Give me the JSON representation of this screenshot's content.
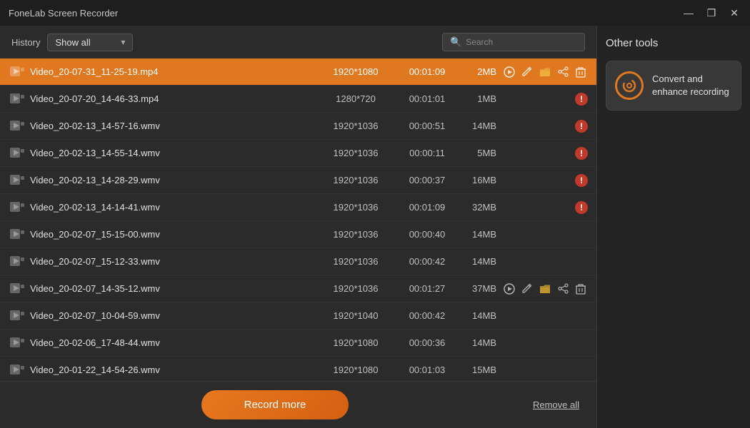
{
  "app": {
    "title": "FoneLab Screen Recorder",
    "window_controls": {
      "minimize": "—",
      "maximize": "❐",
      "close": "✕"
    }
  },
  "header": {
    "history_label": "History",
    "dropdown_value": "Show all",
    "dropdown_arrow": "▾",
    "search_placeholder": "Search"
  },
  "table": {
    "rows": [
      {
        "filename": "Video_20-07-31_11-25-19.mp4",
        "resolution": "1920*1080",
        "duration": "00:01:09",
        "size": "2MB",
        "selected": true,
        "error": false,
        "show_actions": true
      },
      {
        "filename": "Video_20-07-20_14-46-33.mp4",
        "resolution": "1280*720",
        "duration": "00:01:01",
        "size": "1MB",
        "selected": false,
        "error": true,
        "show_actions": false
      },
      {
        "filename": "Video_20-02-13_14-57-16.wmv",
        "resolution": "1920*1036",
        "duration": "00:00:51",
        "size": "14MB",
        "selected": false,
        "error": true,
        "show_actions": false
      },
      {
        "filename": "Video_20-02-13_14-55-14.wmv",
        "resolution": "1920*1036",
        "duration": "00:00:11",
        "size": "5MB",
        "selected": false,
        "error": true,
        "show_actions": false
      },
      {
        "filename": "Video_20-02-13_14-28-29.wmv",
        "resolution": "1920*1036",
        "duration": "00:00:37",
        "size": "16MB",
        "selected": false,
        "error": true,
        "show_actions": false
      },
      {
        "filename": "Video_20-02-13_14-14-41.wmv",
        "resolution": "1920*1036",
        "duration": "00:01:09",
        "size": "32MB",
        "selected": false,
        "error": true,
        "show_actions": false
      },
      {
        "filename": "Video_20-02-07_15-15-00.wmv",
        "resolution": "1920*1036",
        "duration": "00:00:40",
        "size": "14MB",
        "selected": false,
        "error": false,
        "show_actions": false
      },
      {
        "filename": "Video_20-02-07_15-12-33.wmv",
        "resolution": "1920*1036",
        "duration": "00:00:42",
        "size": "14MB",
        "selected": false,
        "error": false,
        "show_actions": false
      },
      {
        "filename": "Video_20-02-07_14-35-12.wmv",
        "resolution": "1920*1036",
        "duration": "00:01:27",
        "size": "37MB",
        "selected": false,
        "error": false,
        "show_actions": true
      },
      {
        "filename": "Video_20-02-07_10-04-59.wmv",
        "resolution": "1920*1040",
        "duration": "00:00:42",
        "size": "14MB",
        "selected": false,
        "error": false,
        "show_actions": false
      },
      {
        "filename": "Video_20-02-06_17-48-44.wmv",
        "resolution": "1920*1080",
        "duration": "00:00:36",
        "size": "14MB",
        "selected": false,
        "error": false,
        "show_actions": false
      },
      {
        "filename": "Video_20-01-22_14-54-26.wmv",
        "resolution": "1920*1080",
        "duration": "00:01:03",
        "size": "15MB",
        "selected": false,
        "error": false,
        "show_actions": false
      }
    ],
    "actions": {
      "play": "▶",
      "edit": "✎",
      "folder": "📁",
      "share": "⬆",
      "delete": "🗑",
      "error_symbol": "!"
    }
  },
  "footer": {
    "record_more_label": "Record more",
    "remove_all_label": "Remove all"
  },
  "right_panel": {
    "title": "Other tools",
    "tools": [
      {
        "id": "convert-enhance",
        "label": "Convert and enhance recording"
      }
    ]
  }
}
